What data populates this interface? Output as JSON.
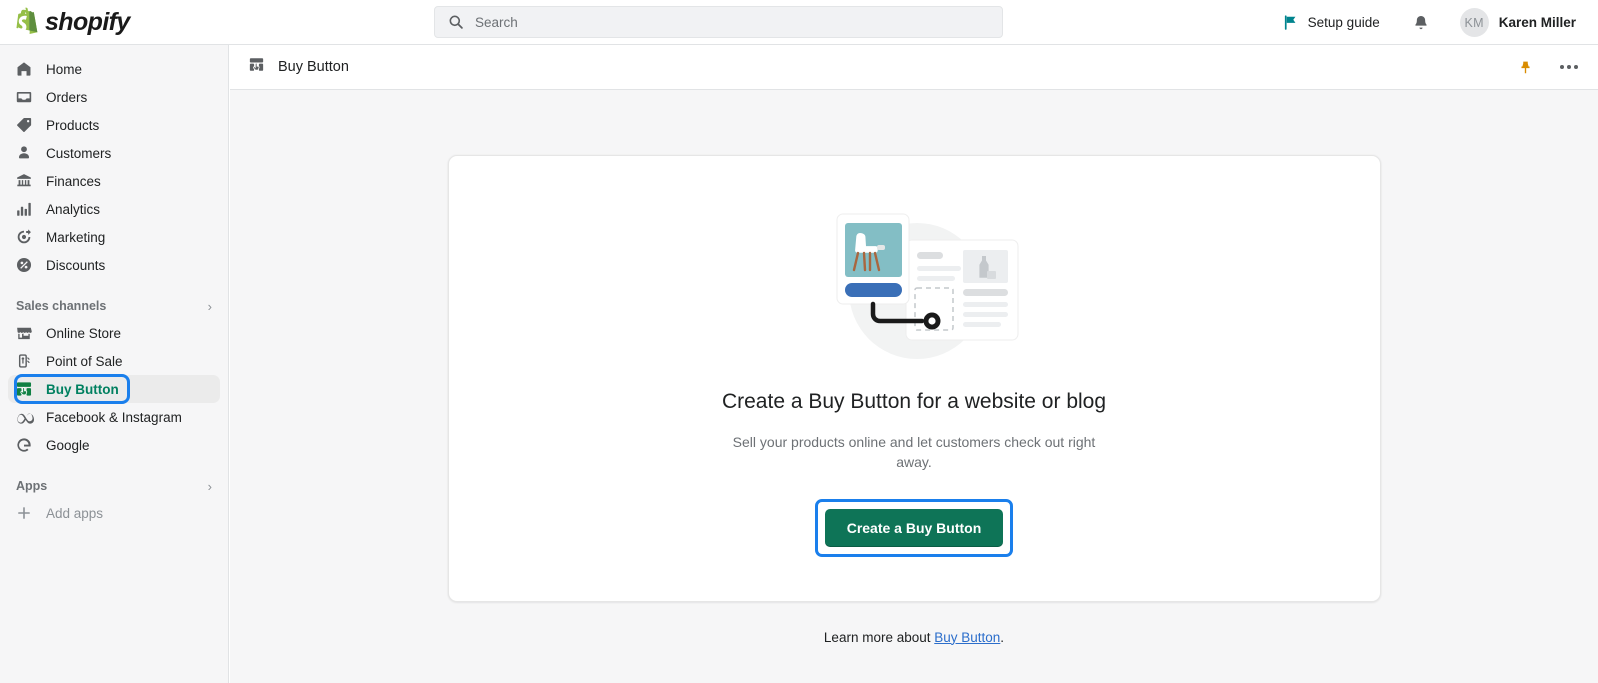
{
  "brand": {
    "name": "shopify",
    "green": "#95bf47",
    "dark_green": "#5e8e3e"
  },
  "topbar": {
    "search": {
      "placeholder": "Search",
      "icon": "search-icon"
    },
    "setup_guide": {
      "label": "Setup guide",
      "icon": "flag-icon",
      "icon_color": "#00848e"
    },
    "notifications_icon": "bell-icon",
    "user": {
      "initials": "KM",
      "name": "Karen Miller"
    }
  },
  "sidebar": {
    "primary_items": [
      {
        "label": "Home",
        "icon": "home-icon"
      },
      {
        "label": "Orders",
        "icon": "orders-inbox-icon"
      },
      {
        "label": "Products",
        "icon": "products-tag-icon"
      },
      {
        "label": "Customers",
        "icon": "customers-person-icon"
      },
      {
        "label": "Finances",
        "icon": "finances-bank-icon"
      },
      {
        "label": "Analytics",
        "icon": "analytics-bars-icon"
      },
      {
        "label": "Marketing",
        "icon": "marketing-target-icon"
      },
      {
        "label": "Discounts",
        "icon": "discounts-percent-icon"
      }
    ],
    "sales_channels": {
      "label": "Sales channels",
      "chevron": "chevron-right-icon",
      "items": [
        {
          "label": "Online Store",
          "icon": "online-store-icon",
          "selected": false
        },
        {
          "label": "Point of Sale",
          "icon": "point-of-sale-icon",
          "selected": false
        },
        {
          "label": "Buy Button",
          "icon": "buy-button-icon",
          "selected": true
        },
        {
          "label": "Facebook & Instagram",
          "icon": "meta-icon",
          "selected": false
        },
        {
          "label": "Google",
          "icon": "google-icon",
          "selected": false
        }
      ]
    },
    "apps": {
      "label": "Apps",
      "chevron": "chevron-right-icon",
      "add_apps": {
        "label": "Add apps",
        "icon": "plus-icon"
      }
    },
    "selected_highlight_color": "#1a7fec",
    "selected_text_color": "#008060"
  },
  "page": {
    "header": {
      "title": "Buy Button",
      "icon": "buy-button-icon",
      "pin_icon": "pin-icon",
      "pin_color": "#d98c00",
      "more_icon": "more-horizontal-icon"
    },
    "empty_state": {
      "illustration": "buy-button-embed-illustration",
      "title": "Create a Buy Button for a website or blog",
      "description": "Sell your products online and let customers check out right away.",
      "cta_label": "Create a Buy Button",
      "cta_color": "#0e7457",
      "cta_focus_ring_color": "#1a7fec"
    },
    "footnote": {
      "prefix": "Learn more about ",
      "link": "Buy Button",
      "suffix": "."
    }
  }
}
